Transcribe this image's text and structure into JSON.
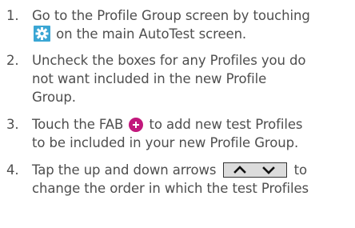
{
  "steps": [
    {
      "number": "1.",
      "line1_before": "Go to the Profile Group screen by touching",
      "line2_after": " on the main AutoTest screen.",
      "icon": "gear-icon",
      "icon_color": "#3aa6d4"
    },
    {
      "number": "2.",
      "line1": "Uncheck the boxes for any Profiles you do",
      "line2": "not want included in the new Profile",
      "line3": "Group."
    },
    {
      "number": "3.",
      "line1_before": "Touch the FAB ",
      "line1_after": " to add new test Profiles",
      "line2": "to be included in your new Profile Group.",
      "icon": "fab-plus-icon",
      "icon_color": "#c2187c"
    },
    {
      "number": "4.",
      "line1_before": "Tap the up and down arrows ",
      "line1_after": " to",
      "line2": "change the order in which the test Profiles",
      "icon": "up-down-arrows-icon"
    }
  ]
}
